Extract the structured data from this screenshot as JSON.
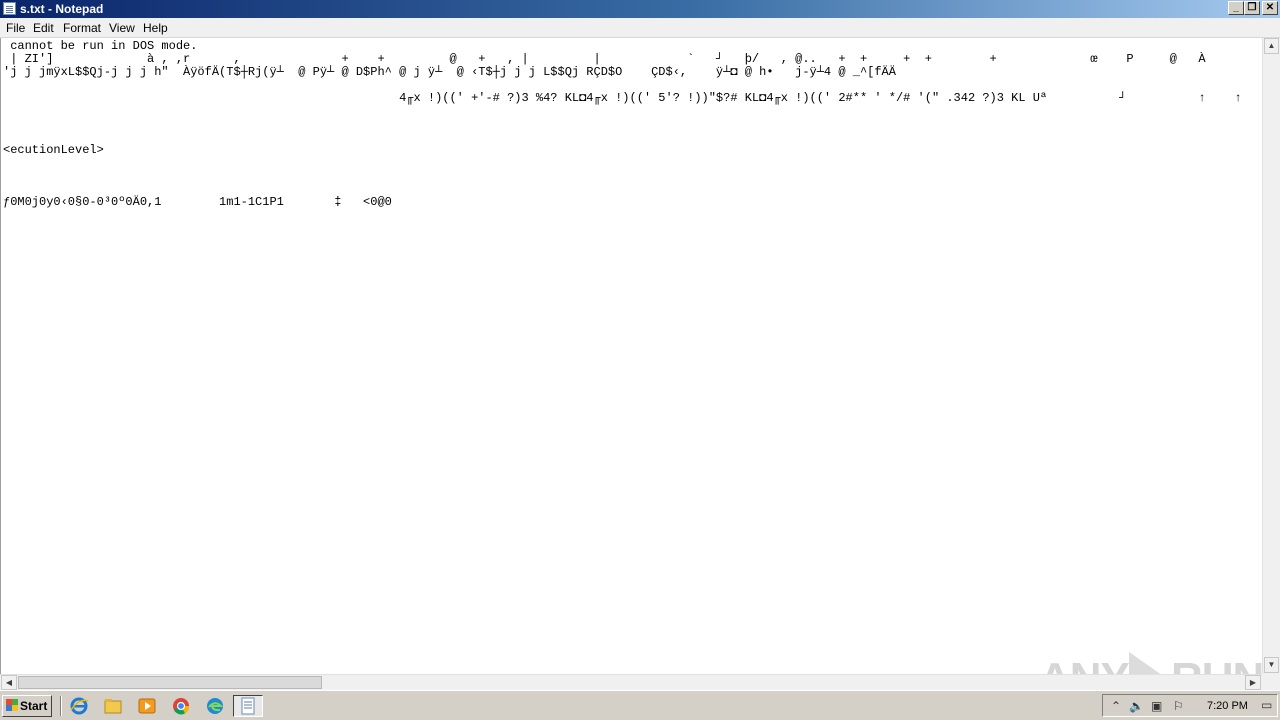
{
  "window": {
    "title": "s.txt - Notepad",
    "min_glyph": "_",
    "max_glyph": "❐",
    "close_glyph": "✕"
  },
  "menu": {
    "items": [
      "File",
      "Edit",
      "Format",
      "View",
      "Help"
    ]
  },
  "editor": {
    "lines": [
      " cannot be run in DOS mode.",
      " | ZI']             à , ,r      ,              +    +         @   +   , |         |            `   ┘   þ/   , @..   +  +     +  +        +             œ    P     @   À                          P   <",
      "'j j jmÿxL$$Qj-j j j h\"  ÀÿöfÄ(T$┼Rj(ÿ┴  @ Pÿ┴ @ D$Ph^ @ j ÿ┴  @ ‹T$┼j j j L$$Qj RÇD$O    ÇD$‹,    ÿ┴◘ @ h•   j-ÿ┴4 @ _^[fÄÄ",
      "                                                       4╓x !)((' +'-# ?)3 %4? KL◘4╓x !)((' 5'? !))\"$?# KL◘4╓x !)((' 2#** ' */# '(\" .342 ?)3 KL Uª          ┘          ↑    ↑   €",
      "",
      "",
      "<ecutionLevel>",
      "",
      "",
      "",
      "ƒ0M0j0y0‹0§0-0³0º0Ä0,1        1m1-1C1P1       ‡   <0@0"
    ]
  },
  "watermark": {
    "left": "ANY",
    "right": "RUN"
  },
  "taskbar": {
    "start_label": "Start",
    "clock": "7:20 PM"
  },
  "colors": {
    "titlebar_start": "#0a246a",
    "titlebar_end": "#a6caf0",
    "taskbar": "#d4d0c8"
  }
}
